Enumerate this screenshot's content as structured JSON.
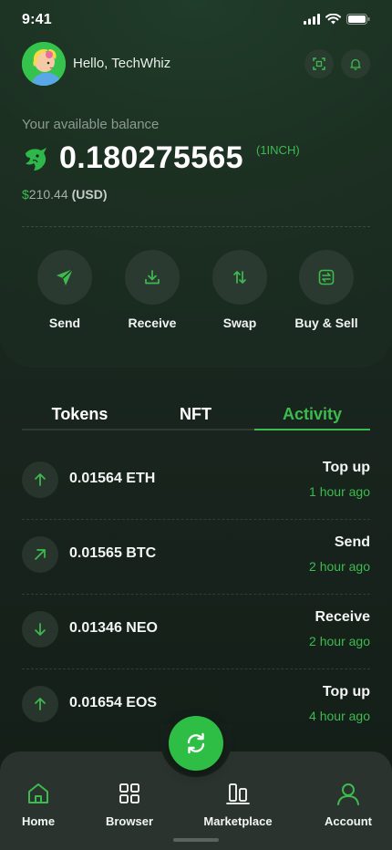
{
  "status_bar": {
    "time": "9:41"
  },
  "header": {
    "greeting": "Hello, TechWhiz"
  },
  "balance": {
    "label": "Your available balance",
    "amount": "0.180275565",
    "unit": "(1INCH)",
    "usd_symbol": "$",
    "usd_value": "210.44",
    "usd_code": "(USD)"
  },
  "actions": [
    {
      "label": "Send",
      "icon": "send-icon"
    },
    {
      "label": "Receive",
      "icon": "download-icon"
    },
    {
      "label": "Swap",
      "icon": "swap-arrows-icon"
    },
    {
      "label": "Buy & Sell",
      "icon": "exchange-icon"
    }
  ],
  "tabs": [
    {
      "label": "Tokens",
      "active": false
    },
    {
      "label": "NFT",
      "active": false
    },
    {
      "label": "Activity",
      "active": true
    }
  ],
  "activity": [
    {
      "amount": "0.01564 ETH",
      "type": "Top up",
      "time": "1 hour ago",
      "icon": "arrow-up-icon"
    },
    {
      "amount": "0.01565 BTC",
      "type": "Send",
      "time": "2 hour ago",
      "icon": "arrow-up-right-icon"
    },
    {
      "amount": "0.01346 NEO",
      "type": "Receive",
      "time": "2 hour ago",
      "icon": "arrow-down-icon"
    },
    {
      "amount": "0.01654 EOS",
      "type": "Top up",
      "time": "4 hour ago",
      "icon": "arrow-up-icon"
    }
  ],
  "nav": [
    {
      "label": "Home",
      "icon": "home-icon",
      "active": true
    },
    {
      "label": "Browser",
      "icon": "grid-icon",
      "active": false
    },
    {
      "label": "Marketplace",
      "icon": "marketplace-icon",
      "active": false
    },
    {
      "label": "Account",
      "icon": "user-icon",
      "active": true
    }
  ],
  "colors": {
    "accent": "#3dbb4f",
    "background": "#17221c",
    "card": "#1c3022",
    "nav_bar": "#2a332e"
  }
}
